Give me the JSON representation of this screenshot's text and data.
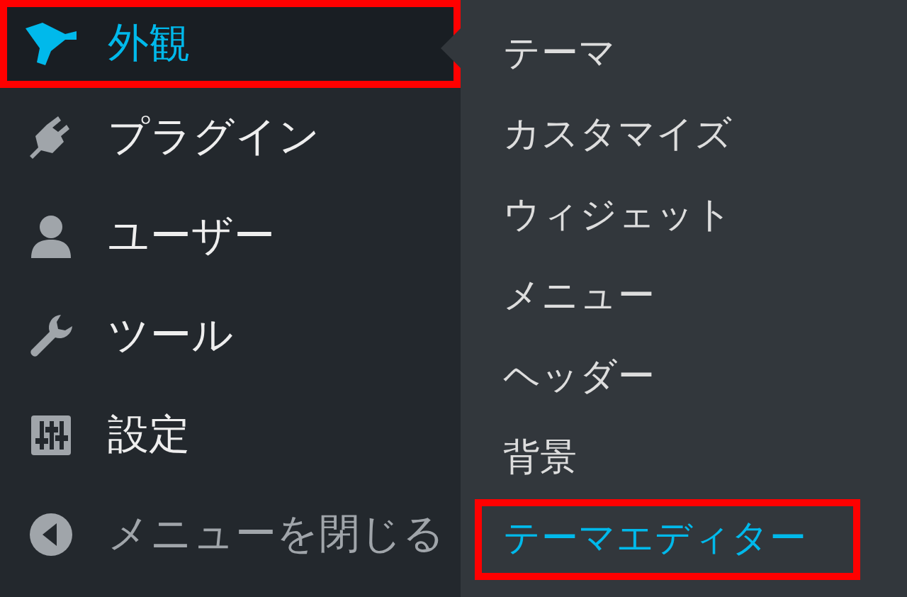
{
  "menu": {
    "items": [
      {
        "label": "外観",
        "current": true,
        "highlighted": true,
        "kind": "item"
      },
      {
        "label": "プラグイン",
        "current": false,
        "highlighted": false,
        "kind": "item"
      },
      {
        "label": "ユーザー",
        "current": false,
        "highlighted": false,
        "kind": "item"
      },
      {
        "label": "ツール",
        "current": false,
        "highlighted": false,
        "kind": "item"
      },
      {
        "label": "設定",
        "current": false,
        "highlighted": false,
        "kind": "item"
      },
      {
        "label": "メニューを閉じる",
        "current": false,
        "highlighted": false,
        "kind": "collapse"
      }
    ]
  },
  "submenu": {
    "items": [
      {
        "label": "テーマ",
        "selected": false,
        "highlighted": false
      },
      {
        "label": "カスタマイズ",
        "selected": false,
        "highlighted": false
      },
      {
        "label": "ウィジェット",
        "selected": false,
        "highlighted": false
      },
      {
        "label": "メニュー",
        "selected": false,
        "highlighted": false
      },
      {
        "label": "ヘッダー",
        "selected": false,
        "highlighted": false
      },
      {
        "label": "背景",
        "selected": false,
        "highlighted": false
      },
      {
        "label": "テーマエディター",
        "selected": true,
        "highlighted": true
      }
    ]
  }
}
